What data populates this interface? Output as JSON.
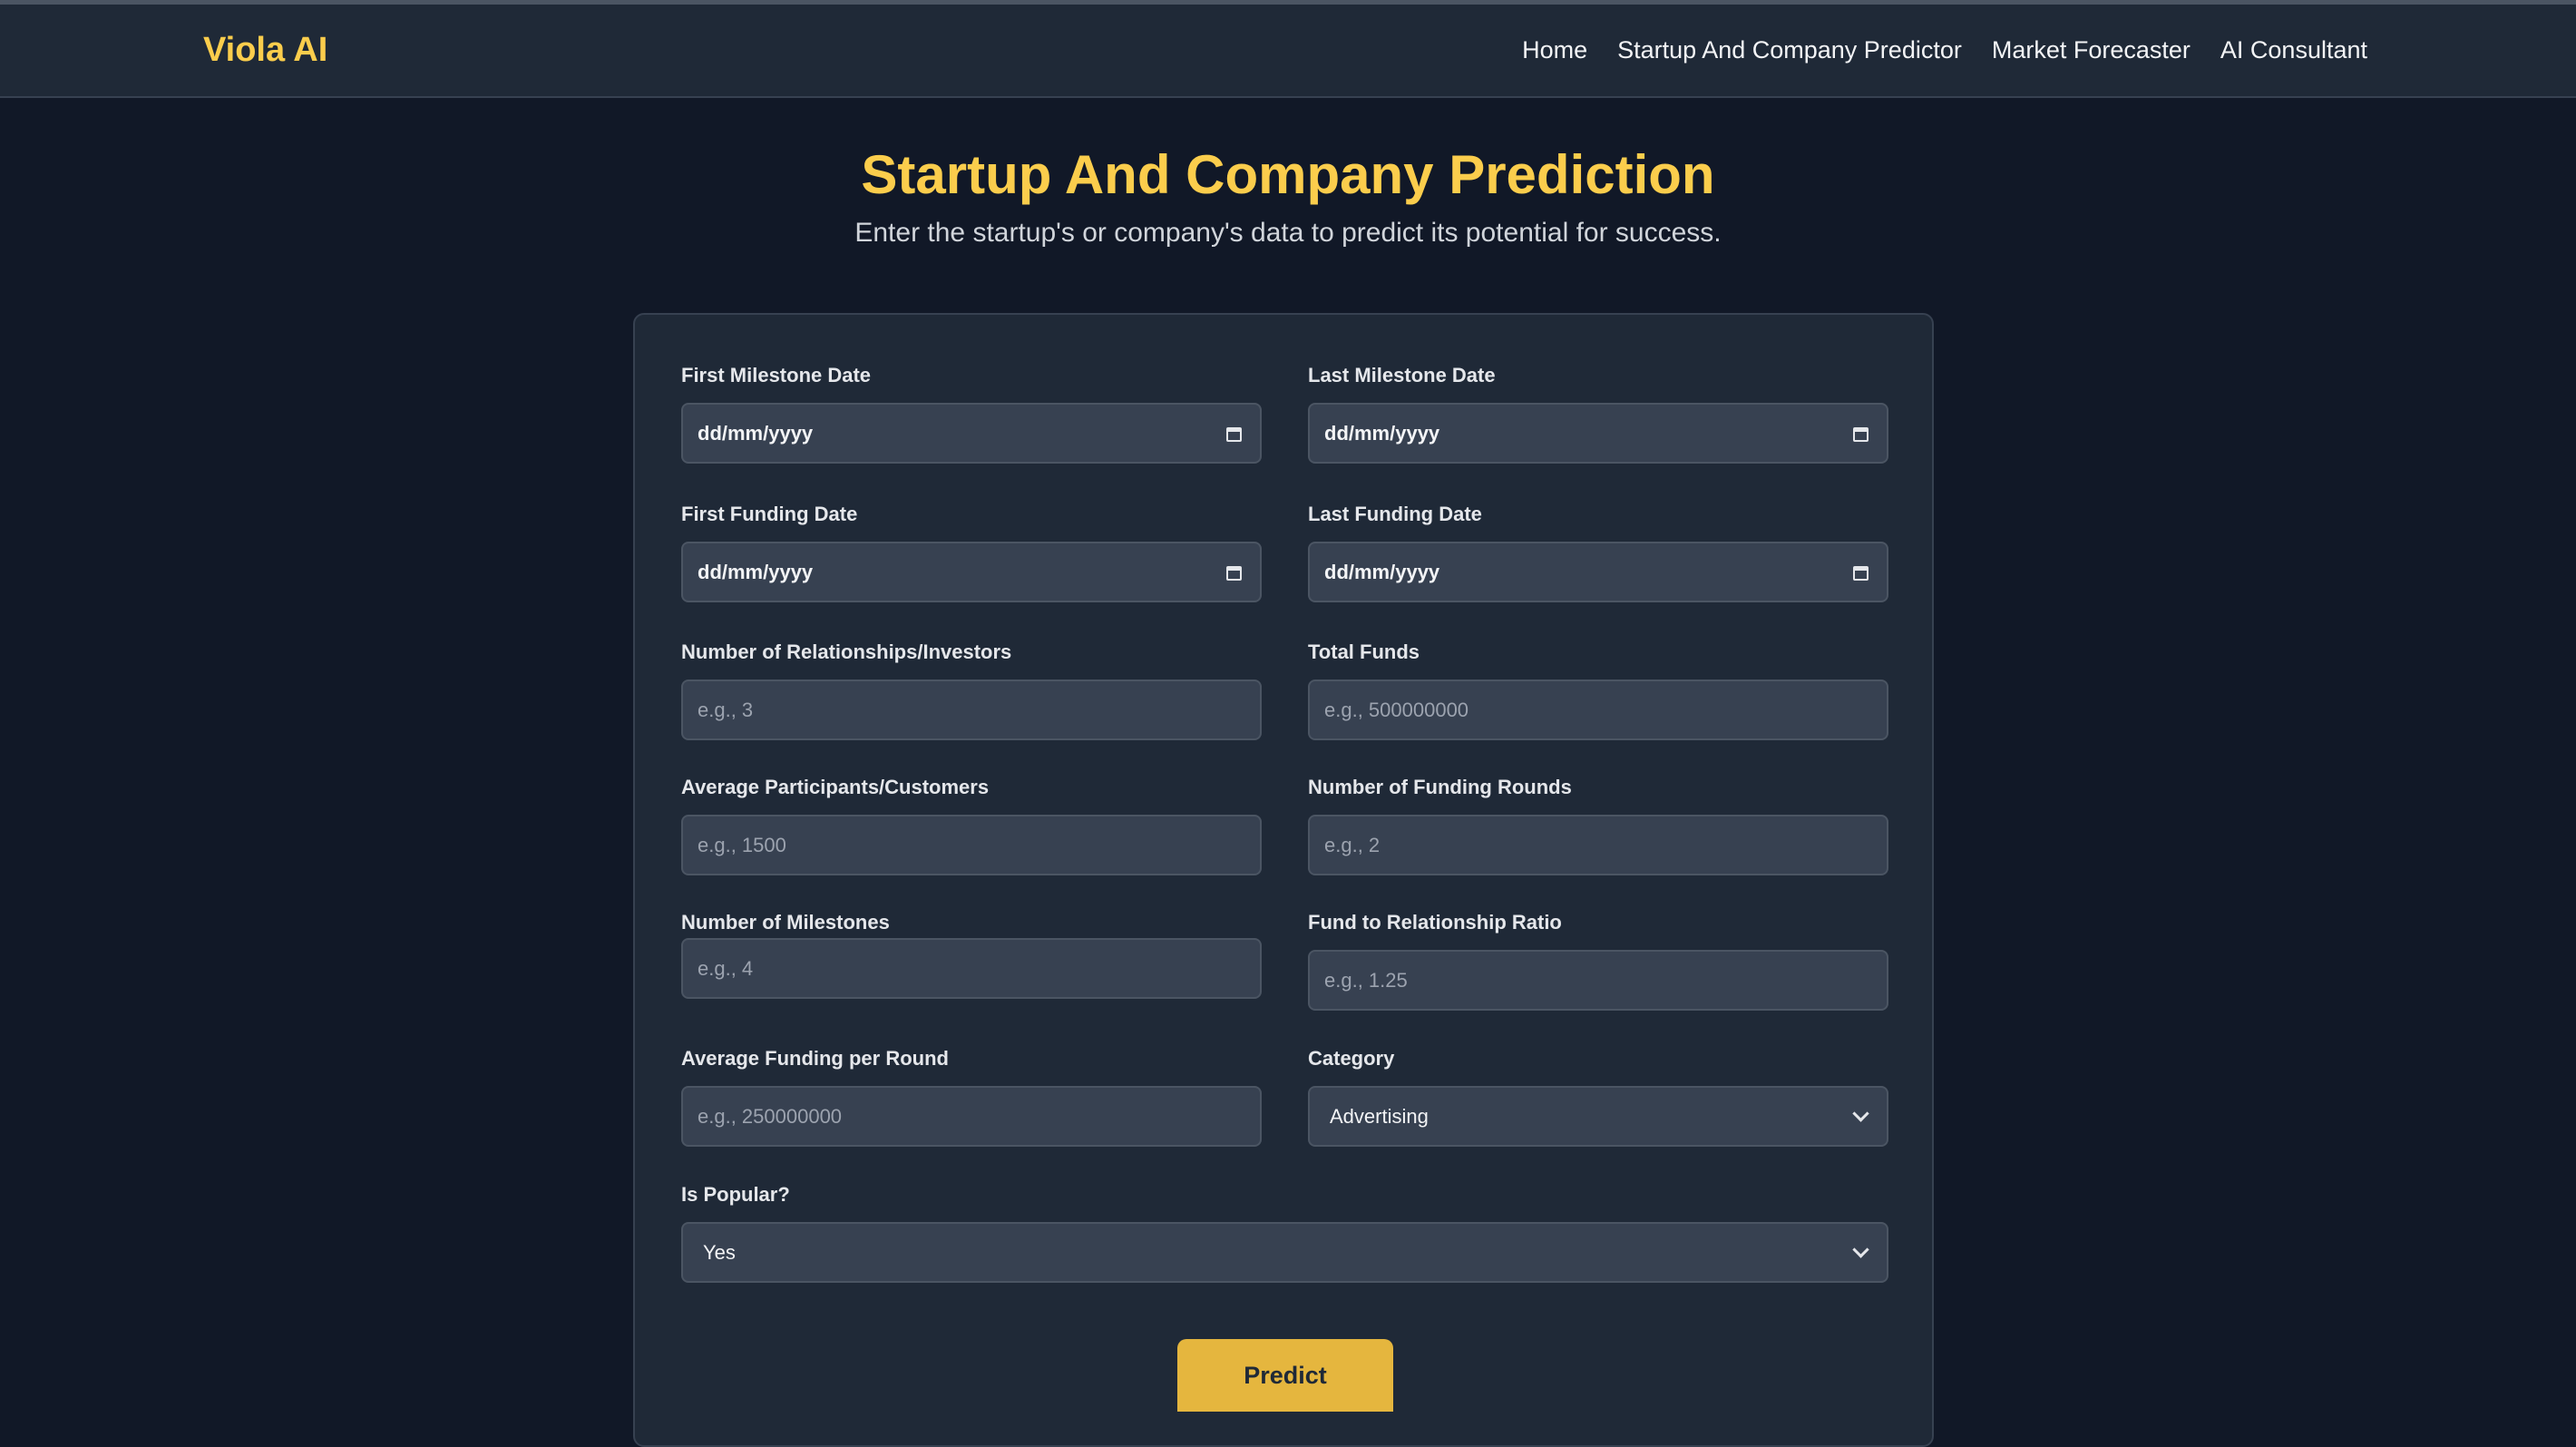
{
  "app": {
    "name": "Viola AI"
  },
  "nav": {
    "items": [
      "Home",
      "Startup And Company Predictor",
      "Market Forecaster",
      "AI Consultant"
    ]
  },
  "hero": {
    "title": "Startup And Company Prediction",
    "subtitle": "Enter the startup's or company's data to predict its potential for success."
  },
  "form": {
    "first_milestone_date": {
      "label": "First Milestone Date",
      "value": "dd/mm/yyyy"
    },
    "last_milestone_date": {
      "label": "Last Milestone Date",
      "value": "dd/mm/yyyy"
    },
    "first_funding_date": {
      "label": "First Funding Date",
      "value": "dd/mm/yyyy"
    },
    "last_funding_date": {
      "label": "Last Funding Date",
      "value": "dd/mm/yyyy"
    },
    "relationships": {
      "label": "Number of Relationships/Investors",
      "placeholder": "e.g., 3"
    },
    "total_funds": {
      "label": "Total Funds",
      "placeholder": "e.g., 500000000"
    },
    "participants": {
      "label": "Average Participants/Customers",
      "placeholder": "e.g., 1500"
    },
    "funding_rounds": {
      "label": "Number of Funding Rounds",
      "placeholder": "e.g., 2"
    },
    "milestones": {
      "label": "Number of Milestones",
      "placeholder": "e.g., 4"
    },
    "fund_ratio": {
      "label": "Fund to Relationship Ratio",
      "placeholder": "e.g., 1.25"
    },
    "avg_funding": {
      "label": "Average Funding per Round",
      "placeholder": "e.g., 250000000"
    },
    "category": {
      "label": "Category",
      "value": "Advertising"
    },
    "is_popular": {
      "label": "Is Popular?",
      "value": "Yes"
    },
    "submit_label": "Predict"
  },
  "colors": {
    "accent": "#fbcd4c",
    "button": "#e5b63e",
    "background": "#111827",
    "panel": "#1f2937",
    "input": "#374151"
  },
  "icons": {
    "date_picker": "calendar-icon",
    "select": "chevron-down-icon"
  }
}
